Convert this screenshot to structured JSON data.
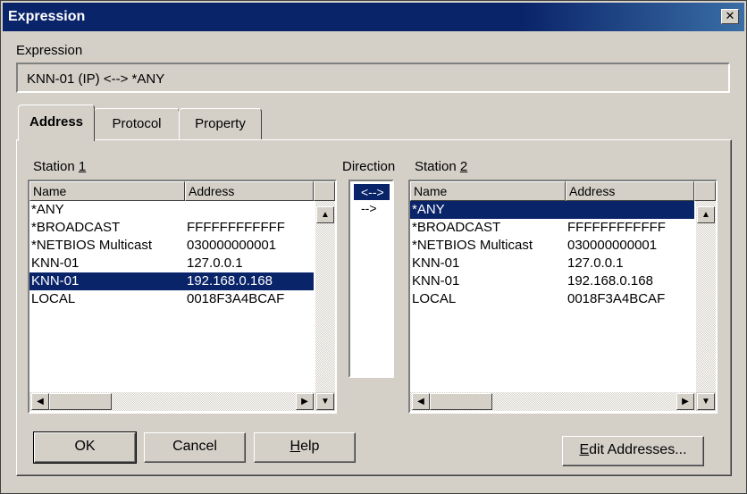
{
  "window": {
    "title": "Expression"
  },
  "expression": {
    "label": "Expression",
    "value": "KNN-01 (IP) <--> *ANY"
  },
  "tabs": [
    {
      "label": "Address",
      "active": true
    },
    {
      "label": "Protocol",
      "active": false
    },
    {
      "label": "Property",
      "active": false
    }
  ],
  "station1": {
    "label_prefix": "Station ",
    "label_mnemonic": "1",
    "columns": [
      "Name",
      "Address"
    ],
    "rows": [
      {
        "name": "*ANY",
        "address": ""
      },
      {
        "name": "*BROADCAST",
        "address": "FFFFFFFFFFFF"
      },
      {
        "name": "*NETBIOS Multicast",
        "address": "030000000001"
      },
      {
        "name": "KNN-01",
        "address": "127.0.0.1"
      },
      {
        "name": "KNN-01",
        "address": "192.168.0.168",
        "selected": true
      },
      {
        "name": "LOCAL",
        "address": "0018F3A4BCAF"
      }
    ]
  },
  "direction": {
    "label": "Direction",
    "options": [
      {
        "label": "<-->",
        "selected": true
      },
      {
        "label": "-->",
        "selected": false
      }
    ]
  },
  "station2": {
    "label_prefix": "Station ",
    "label_mnemonic": "2",
    "columns": [
      "Name",
      "Address"
    ],
    "rows": [
      {
        "name": "*ANY",
        "address": "",
        "selected": true
      },
      {
        "name": "*BROADCAST",
        "address": "FFFFFFFFFFFF"
      },
      {
        "name": "*NETBIOS Multicast",
        "address": "030000000001"
      },
      {
        "name": "KNN-01",
        "address": "127.0.0.1"
      },
      {
        "name": "KNN-01",
        "address": "192.168.0.168"
      },
      {
        "name": "LOCAL",
        "address": "0018F3A4BCAF"
      }
    ]
  },
  "buttons": {
    "ok": "OK",
    "cancel": "Cancel",
    "help_mnemonic": "H",
    "help_rest": "elp",
    "edit_mnemonic": "E",
    "edit_rest": "dit Addresses..."
  },
  "icons": {
    "close": "close-icon",
    "scroll_up": "arrow-up-icon",
    "scroll_down": "arrow-down-icon",
    "scroll_left": "arrow-left-icon",
    "scroll_right": "arrow-right-icon"
  },
  "colors": {
    "selection": "#0a246a",
    "titlebar": "#0a246a",
    "face": "#d4d0c8"
  }
}
